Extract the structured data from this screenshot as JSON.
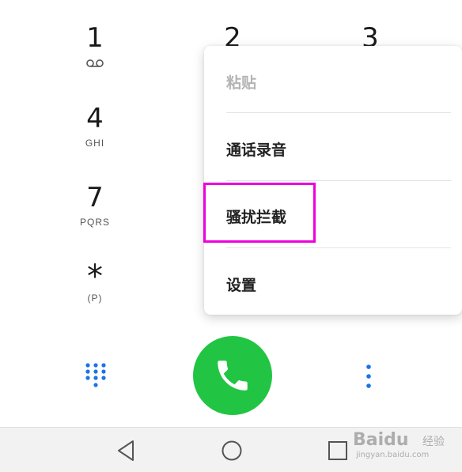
{
  "dialpad": {
    "keys": [
      {
        "digit": "1",
        "letters": ""
      },
      {
        "digit": "2",
        "letters": ""
      },
      {
        "digit": "3",
        "letters": ""
      },
      {
        "digit": "4",
        "letters": "GHI"
      },
      {
        "digit": "7",
        "letters": "PQRS"
      },
      {
        "digit": "*",
        "letters": "(P)"
      }
    ]
  },
  "menu": {
    "items": [
      {
        "label": "粘贴",
        "enabled": false
      },
      {
        "label": "通话录音",
        "enabled": true
      },
      {
        "label": "骚扰拦截",
        "enabled": true,
        "highlighted": true
      },
      {
        "label": "设置",
        "enabled": true
      }
    ]
  },
  "bottom": {
    "dialpad_toggle_icon": "dialpad-grid-icon",
    "call_icon": "phone-icon",
    "more_icon": "more-vertical-icon"
  },
  "navbar": {
    "back_icon": "back-triangle-icon",
    "home_icon": "home-circle-icon",
    "recents_icon": "recents-square-icon"
  },
  "watermark": {
    "brand": "Baidu",
    "suffix": "经验",
    "url": "jingyan.baidu.com"
  },
  "colors": {
    "call_green": "#22c543",
    "accent_blue": "#1a73e8",
    "highlight_magenta": "#ee00dd"
  }
}
